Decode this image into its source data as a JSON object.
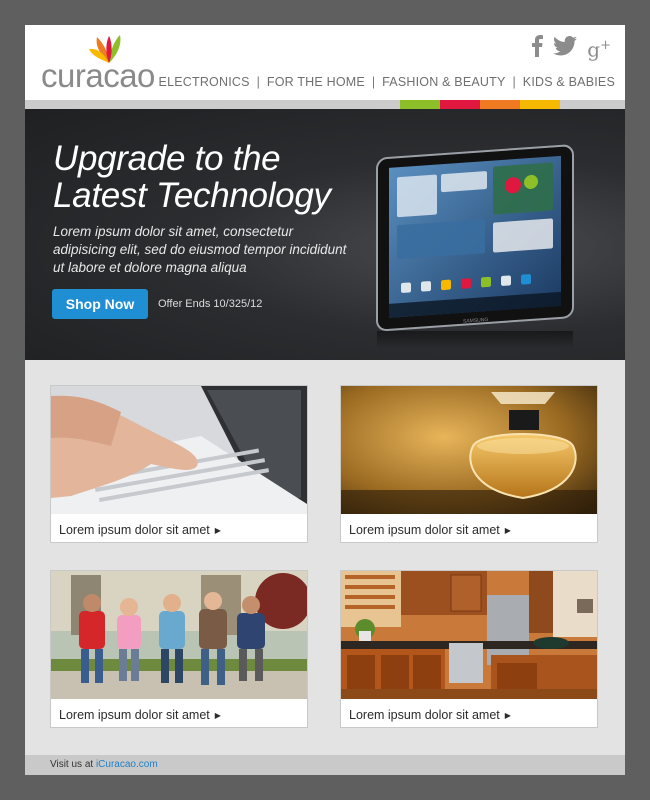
{
  "brand": {
    "name": "curacao"
  },
  "social": [
    {
      "icon": "facebook-icon",
      "glyph": "f"
    },
    {
      "icon": "twitter-icon",
      "glyph": "t"
    },
    {
      "icon": "google-plus-icon",
      "glyph": "g+"
    }
  ],
  "nav": [
    {
      "label": "ELECTRONICS"
    },
    {
      "label": "FOR THE HOME"
    },
    {
      "label": "FASHION & BEAUTY"
    },
    {
      "label": "KIDS & BABIES"
    }
  ],
  "nav_separator": "|",
  "stripe_colors": [
    "#8cbf28",
    "#e0173f",
    "#f07a22",
    "#f6b800"
  ],
  "hero": {
    "title_line1": "Upgrade to the",
    "title_line2": "Latest Technology",
    "body": "Lorem ipsum dolor sit amet, consectetur adipisicing elit, sed do eiusmod tempor incididunt ut labore et dolore magna aliqua",
    "button": "Shop Now",
    "offer": "Offer Ends 10/325/12",
    "tablet_brand": "SAMSUNG"
  },
  "cards": [
    {
      "caption": "Lorem ipsum dolor sit amet",
      "image": "laptop-typing"
    },
    {
      "caption": "Lorem ipsum dolor sit amet",
      "image": "perfume-bottle"
    },
    {
      "caption": "Lorem ipsum dolor sit amet",
      "image": "kids-with-backpacks"
    },
    {
      "caption": "Lorem ipsum dolor sit amet",
      "image": "kitchen"
    }
  ],
  "footer": {
    "prefix": "Visit us at",
    "link": "iCuracao.com"
  },
  "colors": {
    "accent": "#1f8ed3",
    "page_bg": "#5f5f5f"
  }
}
